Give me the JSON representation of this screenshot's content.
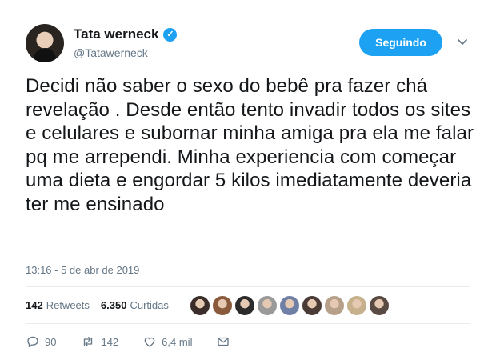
{
  "author": {
    "name": "Tata werneck",
    "handle": "@Tatawerneck",
    "verified_icon": "verified-badge-icon"
  },
  "follow_button": {
    "label": "Seguindo"
  },
  "tweet": {
    "text": "Decidi não saber o sexo do bebê pra fazer chá revelação . Desde então tento invadir todos os sites e celulares e subornar minha amiga pra ela me falar pq me arrependi. Minha experiencia com começar uma dieta e engordar 5 kilos imediatamente deveria ter me ensinado",
    "timestamp": "13:16 - 5 de abr de 2019"
  },
  "stats": {
    "retweets_count": "142",
    "retweets_label": "Retweets",
    "likes_count": "6.350",
    "likes_label": "Curtidas"
  },
  "likers": [
    {
      "color": "#3b2e2a"
    },
    {
      "color": "#8a5a3c"
    },
    {
      "color": "#2b2b2b"
    },
    {
      "color": "#9a9a9a"
    },
    {
      "color": "#6f7fa6"
    },
    {
      "color": "#4a3b36"
    },
    {
      "color": "#b7a08a"
    },
    {
      "color": "#c7b08c"
    },
    {
      "color": "#5a4a44"
    }
  ],
  "actions": {
    "reply_count": "90",
    "retweet_count": "142",
    "like_count": "6,4 mil"
  },
  "colors": {
    "accent": "#1da1f2",
    "secondary_text": "#657786"
  }
}
